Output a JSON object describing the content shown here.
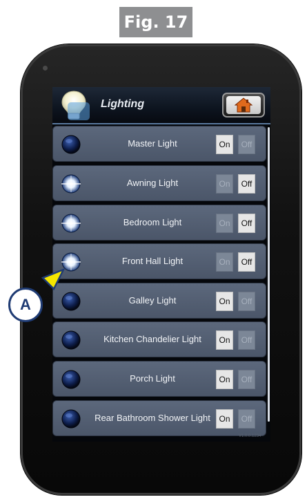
{
  "figure": {
    "label": "Fig. 17"
  },
  "app": {
    "title": "Lighting",
    "icons": {
      "header": "light-bulb-icon",
      "home": "home-icon",
      "row_bulb": "bulb-icon"
    }
  },
  "lights": [
    {
      "name": "Master Light",
      "state": "off",
      "on_label": "On",
      "off_label": "Off"
    },
    {
      "name": "Awning Light",
      "state": "on",
      "on_label": "On",
      "off_label": "Off"
    },
    {
      "name": "Bedroom Light",
      "state": "on",
      "on_label": "On",
      "off_label": "Off"
    },
    {
      "name": "Front Hall Light",
      "state": "on",
      "on_label": "On",
      "off_label": "Off"
    },
    {
      "name": "Galley Light",
      "state": "off",
      "on_label": "On",
      "off_label": "Off"
    },
    {
      "name": "Kitchen Chandelier Light",
      "state": "off",
      "on_label": "On",
      "off_label": "Off"
    },
    {
      "name": "Porch Light",
      "state": "off",
      "on_label": "On",
      "off_label": "Off"
    },
    {
      "name": "Rear Bathroom Shower Light",
      "state": "off",
      "on_label": "On",
      "off_label": "Off"
    }
  ],
  "callout": {
    "label": "A"
  },
  "version_text": "V1.0.0.1234",
  "colors": {
    "callout_border": "#1f3b73",
    "arrow": "#f5e600",
    "row_bg": "#56627a"
  }
}
